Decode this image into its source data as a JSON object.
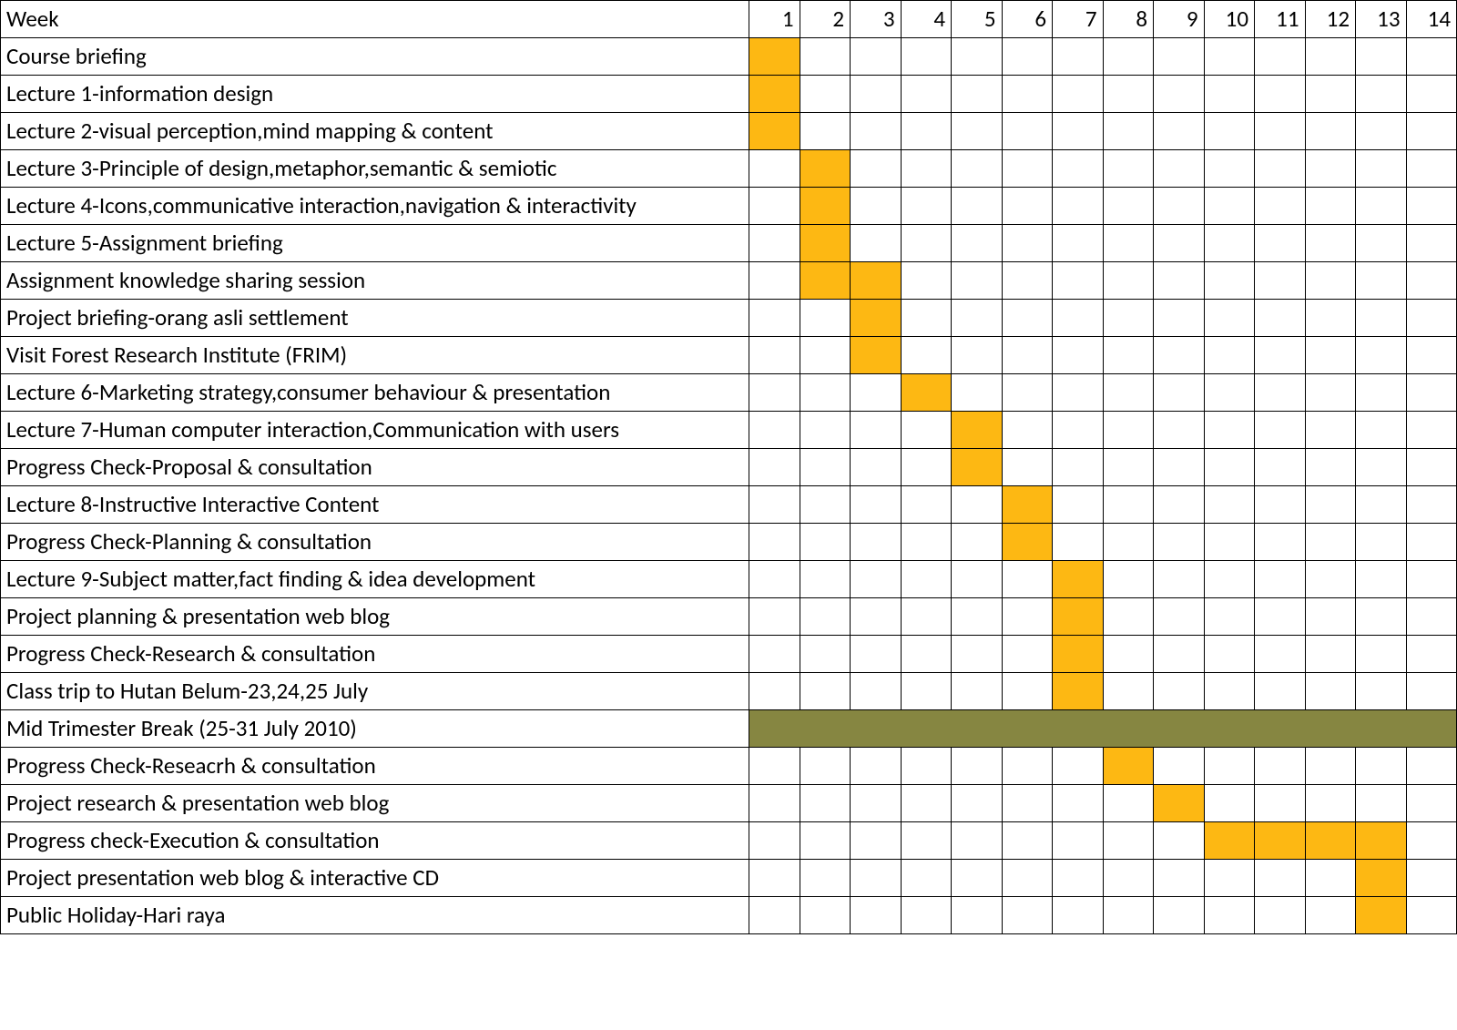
{
  "chart_data": {
    "type": "table",
    "title": "",
    "header_label": "Week",
    "weeks": [
      1,
      2,
      3,
      4,
      5,
      6,
      7,
      8,
      9,
      10,
      11,
      12,
      13,
      14
    ],
    "rows": [
      {
        "label": "Course briefing",
        "weeks": [
          1
        ]
      },
      {
        "label": "Lecture 1-information design",
        "weeks": [
          1
        ]
      },
      {
        "label": "Lecture 2-visual perception,mind mapping & content",
        "weeks": [
          1
        ]
      },
      {
        "label": "Lecture 3-Principle of design,metaphor,semantic & semiotic",
        "weeks": [
          2
        ]
      },
      {
        "label": "Lecture 4-Icons,communicative interaction,navigation & interactivity",
        "weeks": [
          2
        ]
      },
      {
        "label": "Lecture 5-Assignment briefing",
        "weeks": [
          2
        ]
      },
      {
        "label": "Assignment knowledge sharing session",
        "weeks": [
          2,
          3
        ]
      },
      {
        "label": "Project briefing-orang asli settlement",
        "weeks": [
          3
        ]
      },
      {
        "label": "Visit Forest Research Institute (FRIM)",
        "weeks": [
          3
        ]
      },
      {
        "label": "Lecture 6-Marketing strategy,consumer behaviour & presentation",
        "weeks": [
          4
        ]
      },
      {
        "label": "Lecture 7-Human computer interaction,Communication with users",
        "weeks": [
          5
        ]
      },
      {
        "label": "Progress Check-Proposal & consultation",
        "weeks": [
          5
        ]
      },
      {
        "label": "Lecture 8-Instructive Interactive Content",
        "weeks": [
          6
        ]
      },
      {
        "label": "Progress Check-Planning & consultation",
        "weeks": [
          6
        ]
      },
      {
        "label": "Lecture 9-Subject matter,fact finding & idea development",
        "weeks": [
          7
        ]
      },
      {
        "label": "Project planning & presentation web blog",
        "weeks": [
          7
        ]
      },
      {
        "label": "Progress Check-Research & consultation",
        "weeks": [
          7
        ]
      },
      {
        "label": "Class trip to Hutan Belum-23,24,25 July",
        "weeks": [
          7
        ]
      },
      {
        "label": "Mid Trimester Break (25-31 July 2010)",
        "break": true
      },
      {
        "label": "Progress Check-Reseacrh & consultation",
        "weeks": [
          8
        ]
      },
      {
        "label": "Project research & presentation web blog",
        "weeks": [
          9
        ]
      },
      {
        "label": "Progress check-Execution & consultation",
        "weeks": [
          10,
          11,
          12,
          13
        ]
      },
      {
        "label": "Project presentation web blog & interactive CD",
        "weeks": [
          13
        ]
      },
      {
        "label": "Public Holiday-Hari raya",
        "weeks": [
          13
        ]
      }
    ]
  }
}
